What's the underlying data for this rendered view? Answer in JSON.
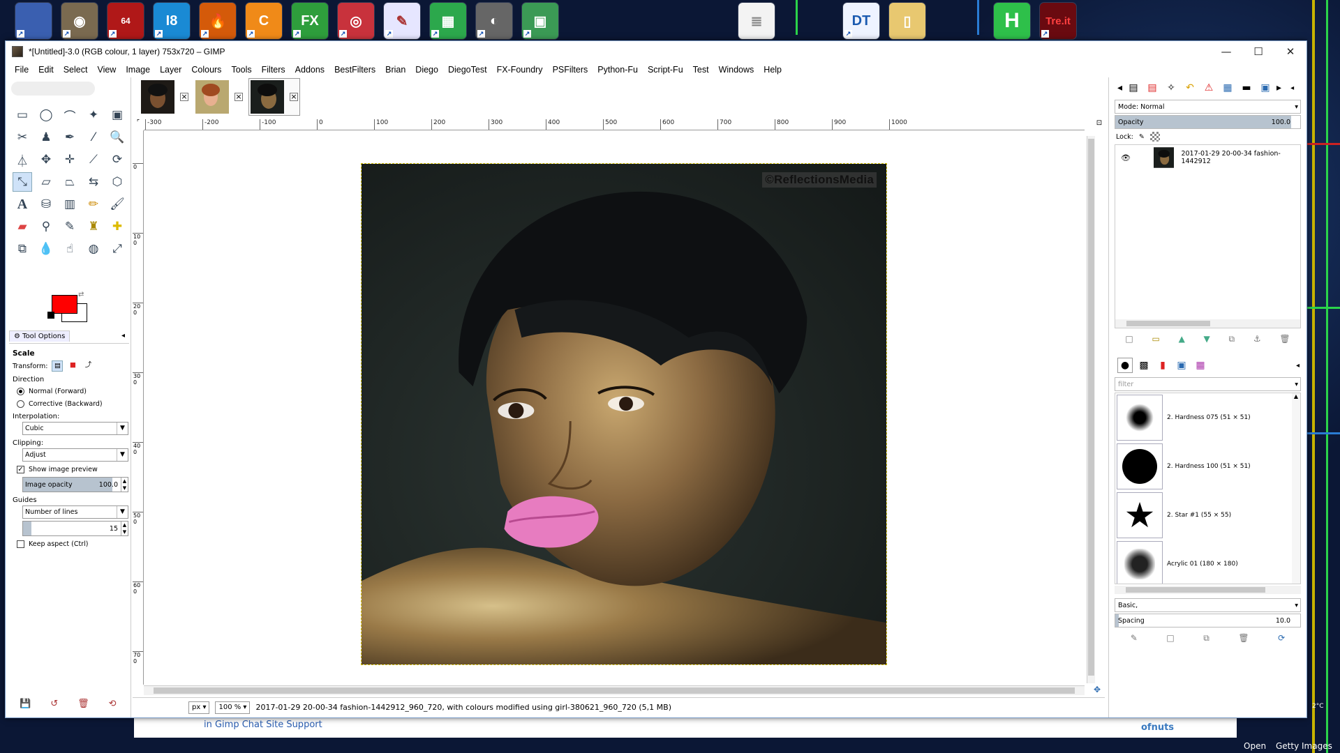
{
  "window": {
    "title": "*[Untitled]-3.0 (RGB colour, 1 layer) 753x720 – GIMP"
  },
  "menubar": [
    "File",
    "Edit",
    "Select",
    "View",
    "Image",
    "Layer",
    "Colours",
    "Tools",
    "Filters",
    "Addons",
    "BestFilters",
    "Brian",
    "Diego",
    "DiegoTest",
    "FX-Foundry",
    "PSFilters",
    "Python-Fu",
    "Script-Fu",
    "Test",
    "Windows",
    "Help"
  ],
  "taskbar": {
    "icons": [
      "files",
      "gimp",
      "ggimp64",
      "i8",
      "fire-app",
      "c-app",
      "fx-app",
      "photo-app",
      "paint-app",
      "folder-app",
      "camera-app",
      "image-app",
      "document",
      "dt-app",
      "folder2",
      "h-app",
      "treit-app"
    ],
    "labels": {
      "i8": "I8",
      "fx": "FX",
      "dt": "DT",
      "h": "H",
      "treit": "Tre.it",
      "gimp64": "64"
    }
  },
  "tool_options": {
    "tab_label": "Tool Options",
    "tool_name": "Scale",
    "transform_label": "Transform:",
    "direction_label": "Direction",
    "direction_normal": "Normal (Forward)",
    "direction_corrective": "Corrective (Backward)",
    "interpolation_label": "Interpolation:",
    "interpolation_value": "Cubic",
    "clipping_label": "Clipping:",
    "clipping_value": "Adjust",
    "show_preview_label": "Show image preview",
    "image_opacity_label": "Image opacity",
    "image_opacity_value": "100.0",
    "image_opacity_pct": 100,
    "guides_label": "Guides",
    "guides_value": "Number of lines",
    "lines_value": "15",
    "keep_aspect_label": "Keep aspect  (Ctrl)"
  },
  "colors": {
    "foreground": "#ff0000",
    "background": "#ffffff",
    "accent": "#cfe2f8"
  },
  "rulers": {
    "horizontal": [
      "-300",
      "-200",
      "-100",
      "0",
      "100",
      "200",
      "300",
      "400",
      "500",
      "600",
      "700",
      "800",
      "900",
      "1000"
    ],
    "vertical": [
      "0",
      "100",
      "200",
      "300",
      "400",
      "500",
      "600",
      "700"
    ]
  },
  "canvas": {
    "watermark": "©ReflectionsMedia"
  },
  "status": {
    "unit": "px",
    "zoom": "100 %",
    "message": "2017-01-29 20-00-34 fashion-1442912_960_720, with colours modified using girl-380621_960_720 (5,1 MB)"
  },
  "layers": {
    "mode_label": "Mode: Normal",
    "opacity_label": "Opacity",
    "opacity_value": "100.0",
    "opacity_pct": 100,
    "lock_label": "Lock:",
    "layer_name": "2017-01-29 20-00-34 fashion-1442912"
  },
  "brushes": {
    "filter_placeholder": "filter",
    "items": [
      {
        "name": "2. Hardness 075 (51 × 51)"
      },
      {
        "name": "2. Hardness 100 (51 × 51)"
      },
      {
        "name": "2. Star #1 (55 × 55)"
      },
      {
        "name": "Acrylic 01 (180 × 180)"
      }
    ],
    "preset_value": "Basic,",
    "spacing_label": "Spacing",
    "spacing_value": "10.0",
    "spacing_pct": 10
  },
  "behind": {
    "forum_link": "in Gimp Chat Site Support",
    "forum_user": "ofnuts",
    "taskbar_open": "Open",
    "getty": "Getty Images",
    "temp": "2°C"
  }
}
